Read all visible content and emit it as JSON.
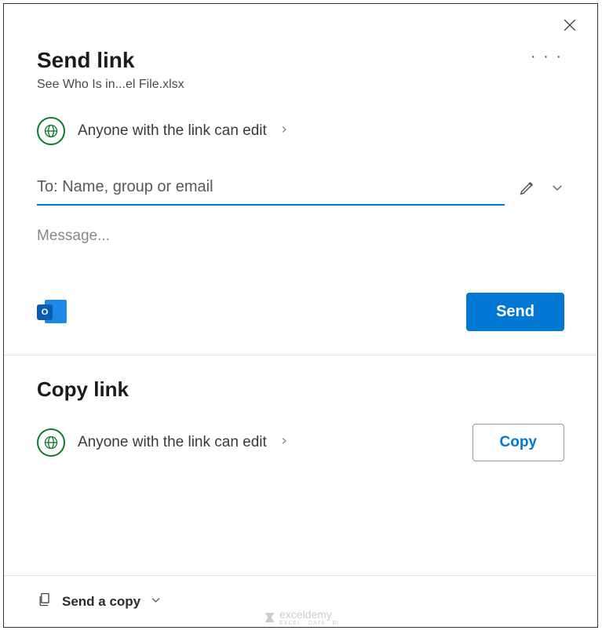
{
  "header": {
    "title": "Send link",
    "filename": "See Who Is in...el File.xlsx"
  },
  "permission": {
    "text": "Anyone with the link can edit"
  },
  "fields": {
    "to_placeholder": "To: Name, group or email",
    "message_placeholder": "Message..."
  },
  "buttons": {
    "send": "Send",
    "copy": "Copy"
  },
  "copySection": {
    "title": "Copy link",
    "permission": "Anyone with the link can edit"
  },
  "footer": {
    "sendCopy": "Send a copy"
  },
  "outlook": {
    "letter": "O"
  },
  "watermark": {
    "name": "exceldemy",
    "sub": "EXCEL · DATA · BI"
  }
}
